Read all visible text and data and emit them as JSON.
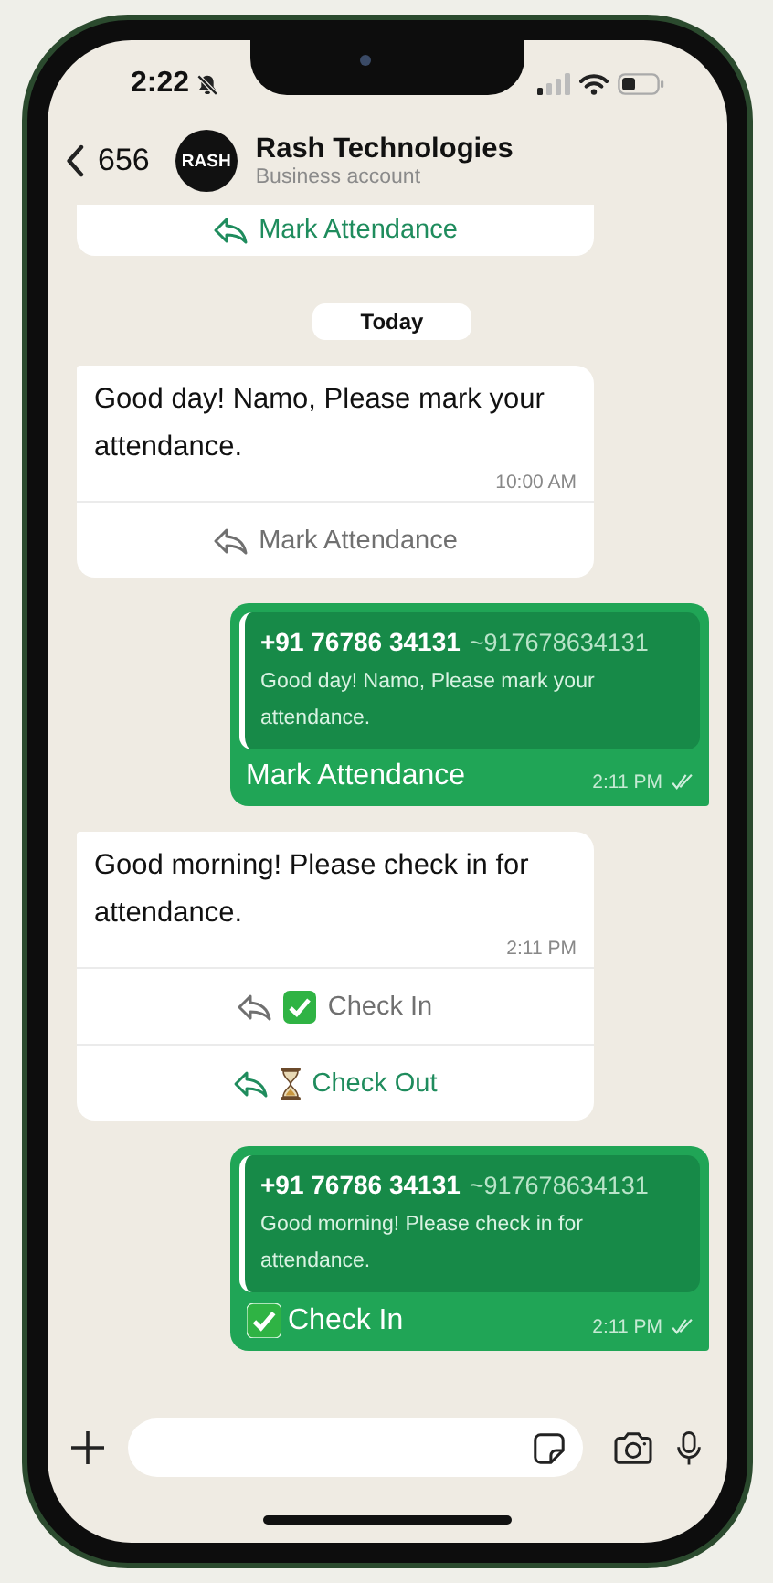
{
  "status_bar": {
    "time": "2:22",
    "silent": true
  },
  "header": {
    "back_count": "656",
    "avatar_text": "RASH",
    "name": "Rash Technologies",
    "subtitle": "Business account"
  },
  "messages": [
    {
      "kind": "buttons_only",
      "buttons": [
        {
          "label": "Mark Attendance",
          "disabled": false
        }
      ]
    },
    {
      "kind": "date",
      "text": "Today"
    },
    {
      "kind": "incoming",
      "text": "Good day! Namo, Please mark your attendance.",
      "time": "10:00 AM",
      "buttons": [
        {
          "label": "Mark Attendance",
          "disabled": true
        }
      ]
    },
    {
      "kind": "outgoing",
      "quote": {
        "number": "+91 76786 34131",
        "name": "~917678634131",
        "text": "Good day! Namo, Please mark your attendance."
      },
      "reply": {
        "kind": "plain",
        "text": "Mark Attendance"
      },
      "time": "2:11 PM",
      "read": true
    },
    {
      "kind": "incoming",
      "text": "Good morning! Please check in for attendance.",
      "time": "2:11 PM",
      "buttons": [
        {
          "label": "Check In",
          "kind": "check",
          "disabled": true
        },
        {
          "label": "Check Out",
          "kind": "hourglass",
          "disabled": false
        }
      ]
    },
    {
      "kind": "outgoing",
      "quote": {
        "number": "+91 76786 34131",
        "name": "~917678634131",
        "text": "Good morning! Please check in for attendance."
      },
      "reply": {
        "kind": "check",
        "text": "Check In"
      },
      "time": "2:11 PM",
      "read": true
    }
  ]
}
